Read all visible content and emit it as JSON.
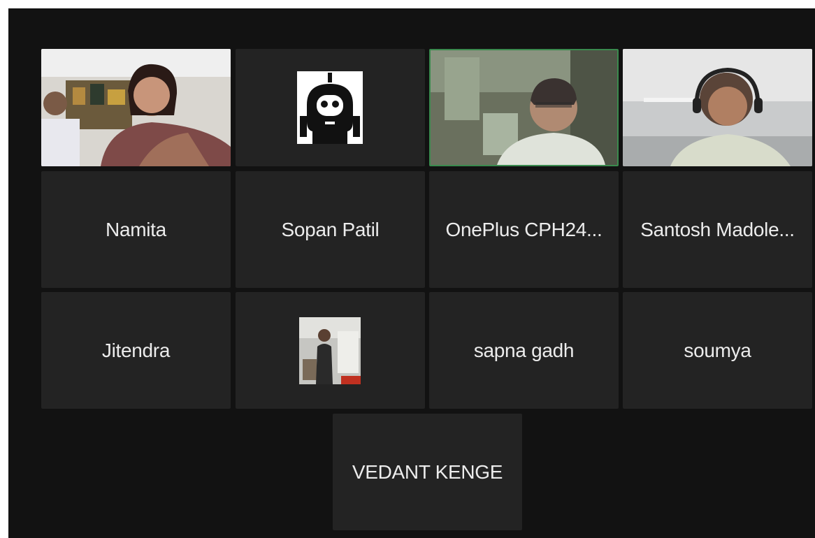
{
  "meeting": {
    "participants": [
      {
        "name": "Namita",
        "video_on": true
      },
      {
        "name": "Sopan Patil",
        "video_on": false,
        "avatar": "robot-avatar-icon"
      },
      {
        "name": "OnePlus CPH24...",
        "video_on": true,
        "active_speaker": true
      },
      {
        "name": "Santosh Madole...",
        "video_on": true
      },
      {
        "name": "Jitendra",
        "video_on": false
      },
      {
        "name": "",
        "video_on": false,
        "avatar": "photo-avatar"
      },
      {
        "name": "sapna gadh",
        "video_on": false
      },
      {
        "name": "soumya",
        "video_on": false
      },
      {
        "name": "VEDANT KENGE",
        "video_on": false
      }
    ],
    "colors": {
      "background": "#121212",
      "tile": "#232323",
      "active_speaker_border": "#3a8a4e",
      "name_text": "#ececec"
    }
  }
}
